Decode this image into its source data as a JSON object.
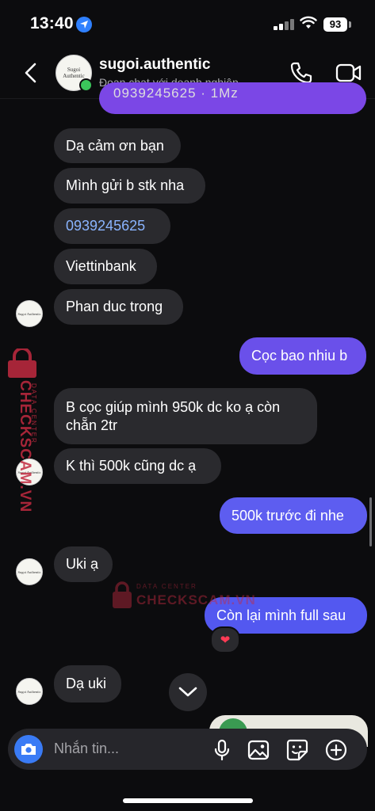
{
  "status_bar": {
    "time": "13:40",
    "battery": "93"
  },
  "header": {
    "name": "sugoi.authentic",
    "subtitle": "Đoạn chat với doanh nghiệp",
    "avatar_text": "Sugoi Authentic"
  },
  "messages": {
    "peek_text": "0939245625 · 1Mz",
    "m1": "Dạ cảm ơn bạn",
    "m2": "Mình gửi b stk nha",
    "m3": "0939245625",
    "m4": "Viettinbank",
    "m5": "Phan duc trong",
    "m6": "Cọc bao nhiu b",
    "m7": "B cọc giúp mình 950k dc ko ạ còn chẵn 2tr",
    "m8": "K thì 500k cũng dc ạ",
    "m9": "500k trước đi nhe",
    "m10": "Uki ạ",
    "m11": "Còn lại mình full sau",
    "m11_reaction": "❤",
    "m12": "Dạ uki"
  },
  "watermark": {
    "vertical_main": "CHECKSCAM.VN",
    "vertical_sub": "DATA CENTER",
    "mid_sub": "DATA CENTER",
    "mid_main": "CHECKSCAM.VN"
  },
  "composer": {
    "placeholder": "Nhắn tin..."
  },
  "colors": {
    "outgoing_top": "#7b47e6",
    "outgoing_bottom": "#5c5ef0",
    "incoming": "#2a2a2e",
    "accent": "#3a7bf5",
    "watermark": "#c22a40"
  },
  "icons": [
    "back-chevron-icon",
    "phone-icon",
    "video-camera-icon",
    "camera-icon",
    "microphone-icon",
    "image-icon",
    "sticker-icon",
    "plus-circle-icon",
    "chevron-down-icon"
  ]
}
